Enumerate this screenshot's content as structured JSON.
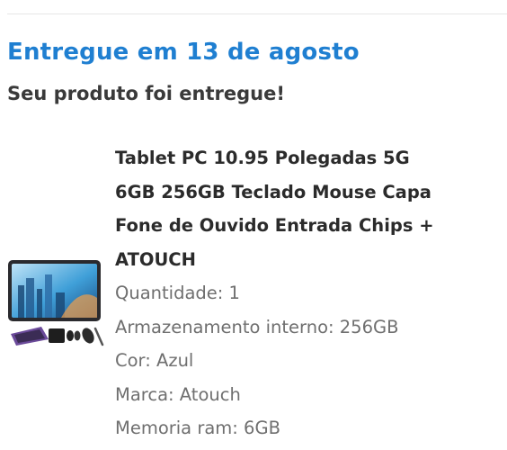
{
  "order": {
    "status_title": "Entregue em 13 de agosto",
    "status_subtitle": "Seu produto foi entregue!"
  },
  "product": {
    "name_lines": [
      "Tablet PC 10.95 Polegadas 5G",
      "6GB 256GB Teclado Mouse Capa",
      "Fone de Ouvido Entrada Chips +",
      "ATOUCH"
    ],
    "attributes": [
      "Quantidade: 1",
      "Armazenamento interno: 256GB",
      "Cor: Azul",
      "Marca: Atouch",
      "Memoria ram: 6GB"
    ]
  },
  "colors": {
    "accent": "#1f7fd1",
    "title_text": "#3a3a3a",
    "muted_text": "#6f6f6f"
  }
}
